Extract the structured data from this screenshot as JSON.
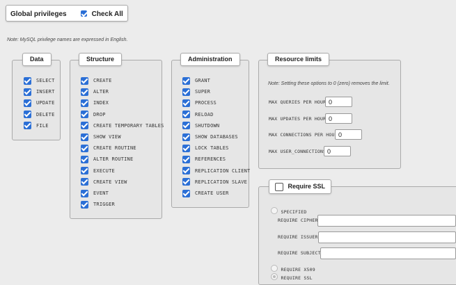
{
  "header": {
    "title": "Global privileges",
    "check_all_label": "Check All",
    "check_all_checked": true
  },
  "note": "Note: MySQL privilege names are expressed in English.",
  "groups": {
    "data": {
      "title": "Data",
      "items": [
        "SELECT",
        "INSERT",
        "UPDATE",
        "DELETE",
        "FILE"
      ]
    },
    "structure": {
      "title": "Structure",
      "items": [
        "CREATE",
        "ALTER",
        "INDEX",
        "DROP",
        "CREATE TEMPORARY TABLES",
        "SHOW VIEW",
        "CREATE ROUTINE",
        "ALTER ROUTINE",
        "EXECUTE",
        "CREATE VIEW",
        "EVENT",
        "TRIGGER"
      ]
    },
    "administration": {
      "title": "Administration",
      "items": [
        "GRANT",
        "SUPER",
        "PROCESS",
        "RELOAD",
        "SHUTDOWN",
        "SHOW DATABASES",
        "LOCK TABLES",
        "REFERENCES",
        "REPLICATION CLIENT",
        "REPLICATION SLAVE",
        "CREATE USER"
      ]
    }
  },
  "resource_limits": {
    "title": "Resource limits",
    "note": "Note: Setting these options to 0 (zero) removes the limit.",
    "fields": [
      {
        "label": "MAX QUERIES PER HOUR",
        "value": "0"
      },
      {
        "label": "MAX UPDATES PER HOUR",
        "value": "0"
      },
      {
        "label": "MAX CONNECTIONS PER HOUR",
        "value": "0"
      },
      {
        "label": "MAX USER_CONNECTIONS",
        "value": "0"
      }
    ]
  },
  "ssl": {
    "title": "Require SSL",
    "checked": false,
    "specified_label": "SPECIFIED",
    "fields": [
      {
        "label": "REQUIRE CIPHER",
        "value": ""
      },
      {
        "label": "REQUIRE ISSUER",
        "value": ""
      },
      {
        "label": "REQUIRE SUBJECT",
        "value": ""
      }
    ],
    "require_x509_label": "REQUIRE X509",
    "require_ssl_label": "REQUIRE SSL"
  }
}
